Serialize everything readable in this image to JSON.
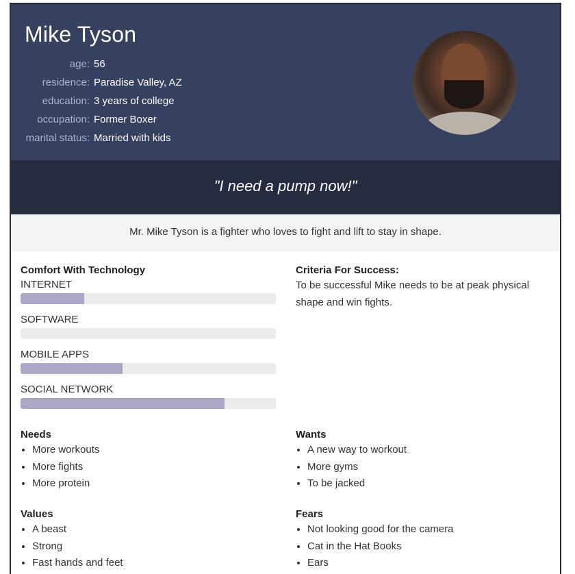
{
  "persona": {
    "name": "Mike Tyson",
    "facts": [
      {
        "label": "age:",
        "value": "56"
      },
      {
        "label": "residence:",
        "value": "Paradise Valley, AZ"
      },
      {
        "label": "education:",
        "value": "3 years of college"
      },
      {
        "label": "occupation:",
        "value": "Former Boxer"
      },
      {
        "label": "marital status:",
        "value": "Married with kids"
      }
    ],
    "quote": "\"I need a pump now!\"",
    "summary": "Mr. Mike Tyson is a fighter who loves to fight and lift to stay in shape."
  },
  "tech": {
    "title": "Comfort With Technology",
    "skills": [
      {
        "label": "INTERNET",
        "level": 0.25
      },
      {
        "label": "SOFTWARE",
        "level": 0.0
      },
      {
        "label": "MOBILE APPS",
        "level": 0.4
      },
      {
        "label": "SOCIAL NETWORK",
        "level": 0.8
      }
    ]
  },
  "criteria": {
    "title": "Criteria For Success:",
    "text": "To be successful Mike needs to be at peak physical shape and win fights."
  },
  "needs": {
    "title": "Needs",
    "items": [
      "More workouts",
      "More fights",
      "More protein"
    ]
  },
  "wants": {
    "title": "Wants",
    "items": [
      "A new way to workout",
      "More gyms",
      "To be jacked"
    ]
  },
  "values": {
    "title": "Values",
    "items": [
      "A beast",
      "Strong",
      "Fast hands and feet"
    ]
  },
  "fears": {
    "title": "Fears",
    "items": [
      "Not looking good for the camera",
      "Cat in the Hat Books",
      "Ears"
    ]
  },
  "colors": {
    "header": "#36405f",
    "quote_band": "#262c40",
    "bar_fill": "#aaa7c7",
    "bar_track": "#ebebeb"
  },
  "icons": {
    "avatar": "profile-photo"
  }
}
